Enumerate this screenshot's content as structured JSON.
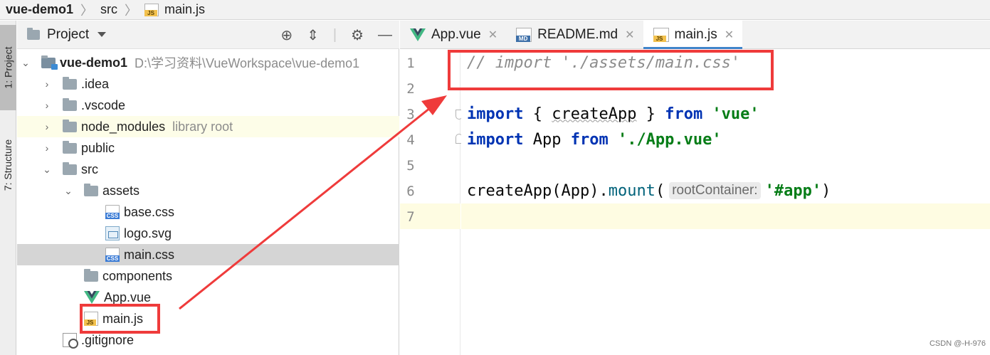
{
  "breadcrumb": {
    "project": "vue-demo1",
    "folder": "src",
    "file": "main.js",
    "file_icon_label": "JS"
  },
  "stripe": {
    "project_tab": "1: Project",
    "structure_tab": "7: Structure"
  },
  "project_panel": {
    "title": "Project",
    "tree": [
      {
        "label": "vue-demo1",
        "path": "D:\\学习资料\\VueWorkspace\\vue-demo1"
      },
      {
        "label": ".idea"
      },
      {
        "label": ".vscode"
      },
      {
        "label": "node_modules",
        "note": "library root"
      },
      {
        "label": "public"
      },
      {
        "label": "src"
      },
      {
        "label": "assets"
      },
      {
        "label": "base.css",
        "icon_label": "CSS"
      },
      {
        "label": "logo.svg"
      },
      {
        "label": "main.css",
        "icon_label": "CSS"
      },
      {
        "label": "components"
      },
      {
        "label": "App.vue"
      },
      {
        "label": "main.js",
        "icon_label": "JS"
      },
      {
        "label": ".gitignore"
      }
    ]
  },
  "tabs": [
    {
      "label": "App.vue"
    },
    {
      "label": "README.md",
      "icon_label": "MD"
    },
    {
      "label": "main.js",
      "icon_label": "JS"
    }
  ],
  "editor": {
    "line_numbers": [
      "1",
      "2",
      "3",
      "4",
      "5",
      "6",
      "7"
    ],
    "line1_comment": "// import './assets/main.css'",
    "line3": {
      "kw1": "import",
      "brace_open": " { ",
      "name": "createApp",
      "brace_close": " } ",
      "kw2": "from",
      "str": " 'vue'"
    },
    "line4": {
      "kw1": "import",
      "name": " App ",
      "kw2": "from",
      "str": " './App.vue'"
    },
    "line6": {
      "fn1": "createApp",
      "arg": "(App).",
      "fn2": "mount",
      "paren": "(",
      "hint": "rootContainer:",
      "str": "'#app'",
      "close": ")"
    }
  },
  "watermark": "CSDN @-H-976",
  "colors": {
    "annotation_red": "#ef3b3b",
    "keyword": "#0033b3",
    "string": "#067d17",
    "comment": "#8c8c8c"
  }
}
